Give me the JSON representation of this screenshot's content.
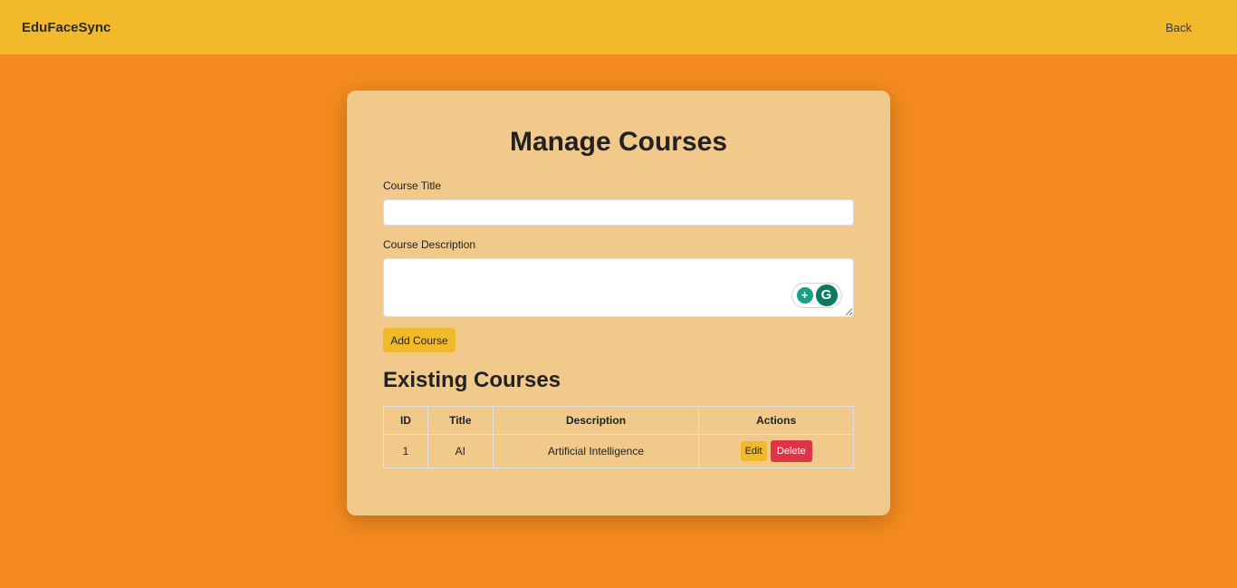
{
  "navbar": {
    "brand": "EduFaceSync",
    "back_label": "Back"
  },
  "form": {
    "heading": "Manage Courses",
    "title_label": "Course Title",
    "title_value": "",
    "description_label": "Course Description",
    "description_value": "",
    "add_button_label": "Add Course"
  },
  "grammarly": {
    "bulb_icon": "lightbulb-icon",
    "logo_icon": "grammarly-icon",
    "bulb_glyph": "+",
    "logo_glyph": "G"
  },
  "courses": {
    "heading": "Existing Courses",
    "columns": [
      "ID",
      "Title",
      "Description",
      "Actions"
    ],
    "rows": [
      {
        "id": "1",
        "title": "AI",
        "description": "Artificial Intelligence",
        "edit_label": "Edit",
        "delete_label": "Delete"
      }
    ]
  },
  "colors": {
    "background": "#f48a1f",
    "navbar": "#f2b92b",
    "card": "#f1c98b",
    "accent": "#f2b92b",
    "danger": "#dc3545"
  }
}
